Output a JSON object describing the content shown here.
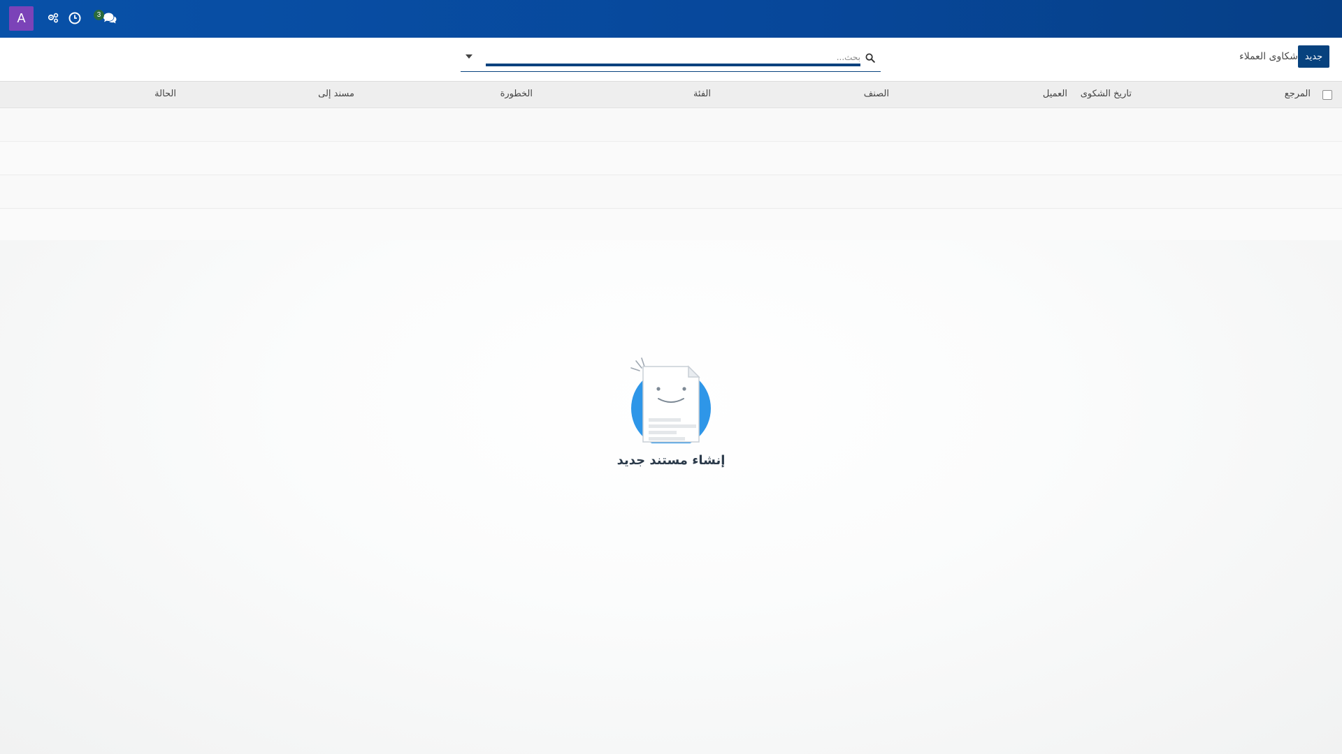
{
  "navbar": {
    "avatar_letter": "A",
    "avatar_color": "#7b43b8",
    "badge_count": "3",
    "icons": [
      "users-cog-icon",
      "clock-icon",
      "chat-bubbles-icon"
    ]
  },
  "control_panel": {
    "new_button_label": "جديد",
    "title": "شكاوى العملاء",
    "search_placeholder": "بحث..."
  },
  "list": {
    "columns": [
      "المرجع",
      "تاريخ الشكوى",
      "العميل",
      "الصنف",
      "الفئة",
      "الخطورة",
      "مسند إلى",
      "الحالة"
    ],
    "empty_rows": 4
  },
  "helper": {
    "title": "إنشاء مستند جديد"
  },
  "colors": {
    "navbar": "#0851a8",
    "primary": "#07427e",
    "badge": "#2a6a3c",
    "illustration_blue": "#2e96e8"
  }
}
